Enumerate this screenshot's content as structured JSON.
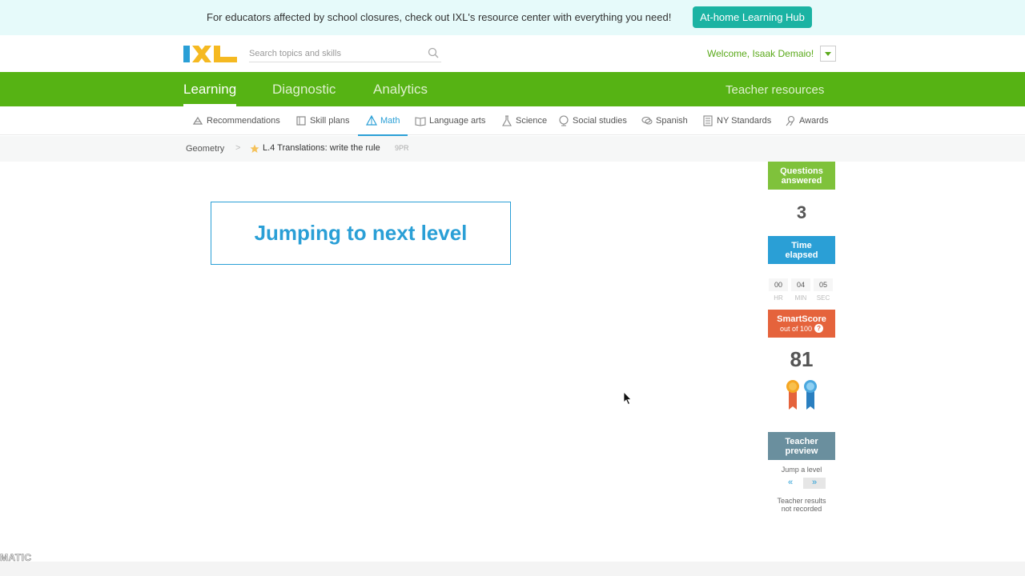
{
  "banner": {
    "text": "For educators affected by school closures, check out IXL's resource center with everything you need!",
    "button": "At-home Learning Hub"
  },
  "header": {
    "logo_text": "IXL",
    "search_placeholder": "Search topics and skills",
    "welcome": "Welcome, Isaak Demaio!"
  },
  "main_nav": {
    "items": [
      "Learning",
      "Diagnostic",
      "Analytics"
    ],
    "active": "Learning",
    "teacher_resources": "Teacher resources"
  },
  "sub_nav": {
    "items": [
      {
        "label": "Recommendations",
        "icon": "recommendations-icon"
      },
      {
        "label": "Skill plans",
        "icon": "skill-plans-icon"
      },
      {
        "label": "Math",
        "icon": "math-icon"
      },
      {
        "label": "Language arts",
        "icon": "book-icon"
      },
      {
        "label": "Science",
        "icon": "flask-icon"
      },
      {
        "label": "Social studies",
        "icon": "globe-icon"
      },
      {
        "label": "Spanish",
        "icon": "speech-bubble-icon"
      },
      {
        "label": "NY Standards",
        "icon": "standards-icon"
      },
      {
        "label": "Awards",
        "icon": "awards-icon"
      }
    ],
    "active": "Math"
  },
  "breadcrumb": {
    "subject": "Geometry",
    "skill": "L.4 Translations: write the rule",
    "code": "9PR"
  },
  "main": {
    "message": "Jumping to next level"
  },
  "sidebar": {
    "questions": {
      "label_1": "Questions",
      "label_2": "answered",
      "value": "3"
    },
    "time": {
      "label_1": "Time",
      "label_2": "elapsed",
      "hr": "00",
      "min": "04",
      "sec": "05",
      "hr_label": "HR",
      "min_label": "MIN",
      "sec_label": "SEC"
    },
    "smartscore": {
      "label": "SmartScore",
      "sub": "out of 100",
      "help": "?",
      "value": "81"
    },
    "teacher_preview": {
      "label_1": "Teacher",
      "label_2": "preview",
      "jump": "Jump a level",
      "prev": "«",
      "next": "»",
      "note_1": "Teacher results",
      "note_2": "not recorded"
    }
  },
  "watermark": "MATIC",
  "colors": {
    "green": "#56b314",
    "blue": "#2a9fd6",
    "orange": "#e5633c",
    "teal": "#1bb3a3",
    "slate": "#6a8f9e"
  }
}
